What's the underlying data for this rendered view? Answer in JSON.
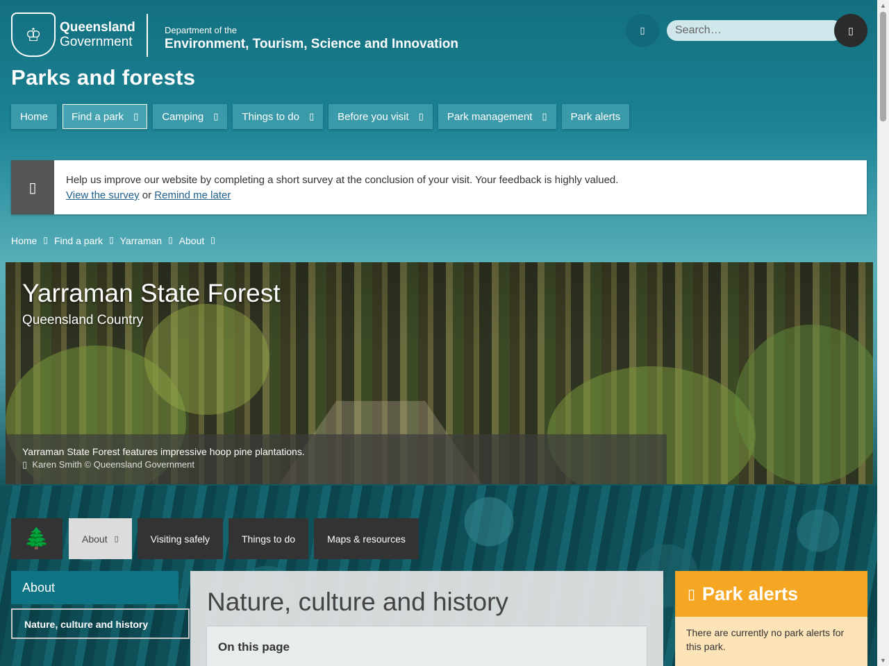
{
  "header": {
    "gov_line1": "Queensland",
    "gov_line2": "Government",
    "dept_small": "Department of the",
    "dept_big": "Environment, Tourism, Science and Innovation",
    "site_title": "Parks and forests"
  },
  "search": {
    "placeholder": "Search…"
  },
  "nav": {
    "items": [
      {
        "label": "Home"
      },
      {
        "label": "Find a park"
      },
      {
        "label": "Camping"
      },
      {
        "label": "Things to do"
      },
      {
        "label": "Before you visit"
      },
      {
        "label": "Park management"
      },
      {
        "label": "Park alerts"
      }
    ]
  },
  "survey": {
    "text": "Help us improve our website by completing a short survey at the conclusion of your visit. Your feedback is highly valued.",
    "link_view": "View the survey",
    "or": "or",
    "link_remind": "Remind me later"
  },
  "breadcrumb": [
    "Home",
    "Find a park",
    "Yarraman",
    "About"
  ],
  "hero": {
    "title": "Yarraman State Forest",
    "subtitle": "Queensland Country",
    "caption": "Yarraman State Forest features impressive hoop pine plantations.",
    "credit": "Karen Smith © Queensland Government"
  },
  "park_tabs": [
    {
      "label": "About"
    },
    {
      "label": "Visiting safely"
    },
    {
      "label": "Things to do"
    },
    {
      "label": "Maps & resources"
    }
  ],
  "sidebar": {
    "section": "About",
    "current": "Nature, culture and history"
  },
  "main": {
    "heading": "Nature, culture and history",
    "on_this_page": "On this page"
  },
  "alerts": {
    "heading": "Park alerts",
    "body": "There are currently no park alerts for this park."
  }
}
